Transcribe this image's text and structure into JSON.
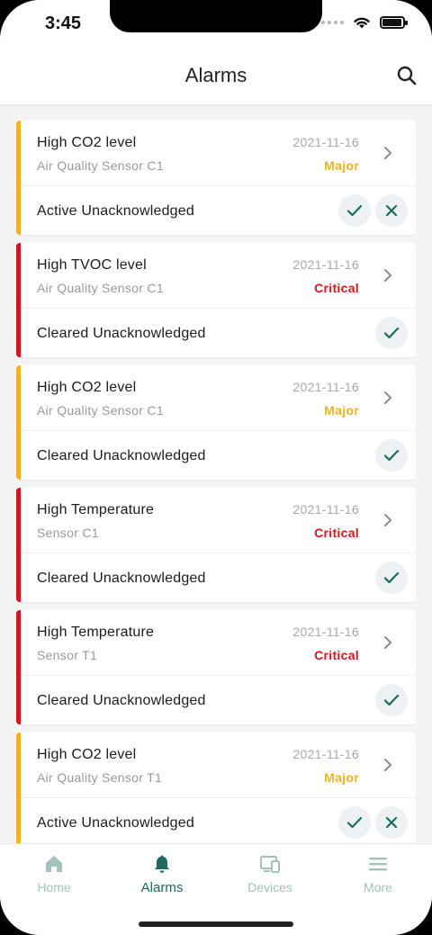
{
  "status_bar": {
    "time": "3:45"
  },
  "header": {
    "title": "Alarms"
  },
  "colors": {
    "major": "#f0b323",
    "critical": "#d4141b",
    "accent": "#1d6b5e",
    "inactive": "#a3c2bd"
  },
  "alarms": [
    {
      "type": "High CO2 level",
      "originator": "Air Quality Sensor C1",
      "date": "2021-11-16",
      "severity": "Major",
      "status": "Active Unacknowledged"
    },
    {
      "type": "High TVOC level",
      "originator": "Air Quality Sensor C1",
      "date": "2021-11-16",
      "severity": "Critical",
      "status": "Cleared Unacknowledged"
    },
    {
      "type": "High CO2 level",
      "originator": "Air Quality Sensor C1",
      "date": "2021-11-16",
      "severity": "Major",
      "status": "Cleared Unacknowledged"
    },
    {
      "type": "High Temperature",
      "originator": "Sensor C1",
      "date": "2021-11-16",
      "severity": "Critical",
      "status": "Cleared Unacknowledged"
    },
    {
      "type": "High Temperature",
      "originator": "Sensor T1",
      "date": "2021-11-16",
      "severity": "Critical",
      "status": "Cleared Unacknowledged"
    },
    {
      "type": "High CO2 level",
      "originator": "Air Quality Sensor T1",
      "date": "2021-11-16",
      "severity": "Major",
      "status": "Active Unacknowledged"
    }
  ],
  "tabs": [
    {
      "label": "Home",
      "icon": "home-icon",
      "active": false
    },
    {
      "label": "Alarms",
      "icon": "bell-icon",
      "active": true
    },
    {
      "label": "Devices",
      "icon": "devices-icon",
      "active": false
    },
    {
      "label": "More",
      "icon": "menu-icon",
      "active": false
    }
  ]
}
